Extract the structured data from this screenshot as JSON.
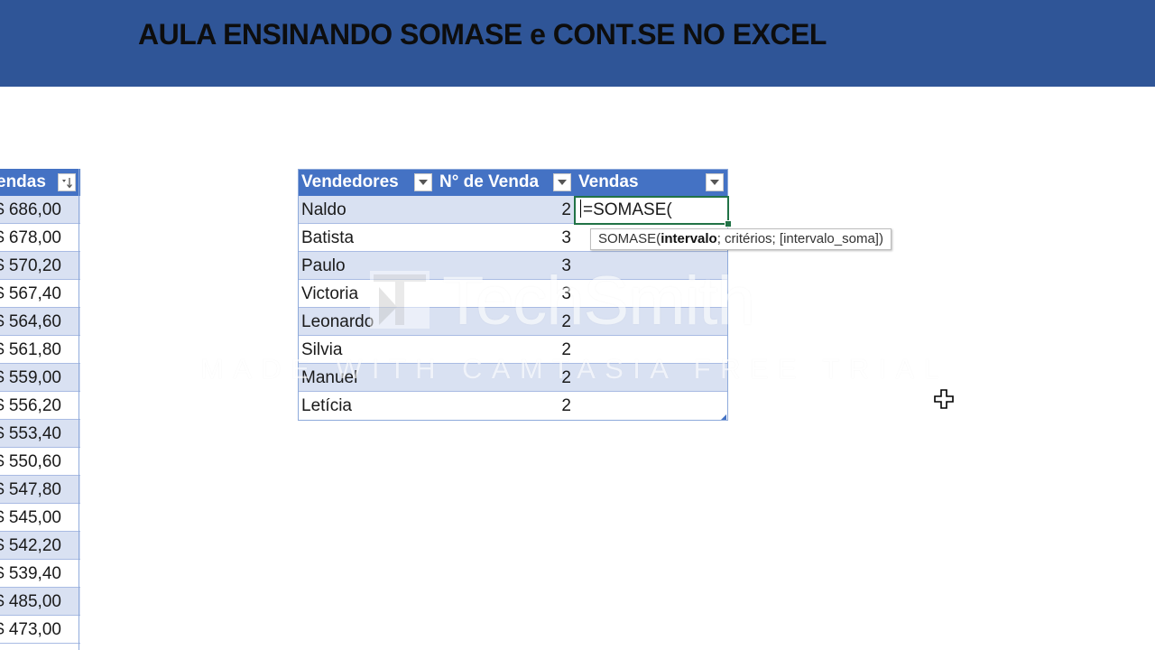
{
  "banner": {
    "title": "AULA ENSINANDO SOMASE e CONT.SE NO EXCEL"
  },
  "left_table": {
    "header": "endas",
    "rows": [
      "$ 686,00",
      "$ 678,00",
      "$ 570,20",
      "$ 567,40",
      "$ 564,60",
      "$ 561,80",
      "$ 559,00",
      "$ 556,20",
      "$ 553,40",
      "$ 550,60",
      "$ 547,80",
      "$ 545,00",
      "$ 542,20",
      "$ 539,40",
      "$ 485,00",
      "$ 473,00"
    ]
  },
  "main_table": {
    "headers": {
      "col1": "Vendedores",
      "col2": "N° de Venda",
      "col3": "Vendas"
    },
    "rows": [
      {
        "name": "Naldo",
        "count": "2"
      },
      {
        "name": "Batista",
        "count": "3"
      },
      {
        "name": "Paulo",
        "count": "3"
      },
      {
        "name": "Victoria",
        "count": "3"
      },
      {
        "name": "Leonardo",
        "count": "2"
      },
      {
        "name": "Silvia",
        "count": "2"
      },
      {
        "name": "Manuel",
        "count": "2"
      },
      {
        "name": "Letícia",
        "count": "2"
      }
    ]
  },
  "active_cell": {
    "formula": "=SOMASE("
  },
  "tooltip": {
    "func": "SOMASE(",
    "arg1": "intervalo",
    "rest": "; critérios; [intervalo_soma])"
  },
  "watermark": {
    "brand": "TechSmith",
    "reg": "®",
    "line": "MADE WITH CAMTASIA FREE TRIAL"
  },
  "colors": {
    "banner": "#2f5597",
    "table_header": "#4472c4",
    "band": "#d9e1f2",
    "cell_border": "#217346"
  },
  "icons": [
    "filter-dropdown-icon",
    "sort-descending-icon",
    "techsmith-logo-icon",
    "move-cursor-icon"
  ]
}
